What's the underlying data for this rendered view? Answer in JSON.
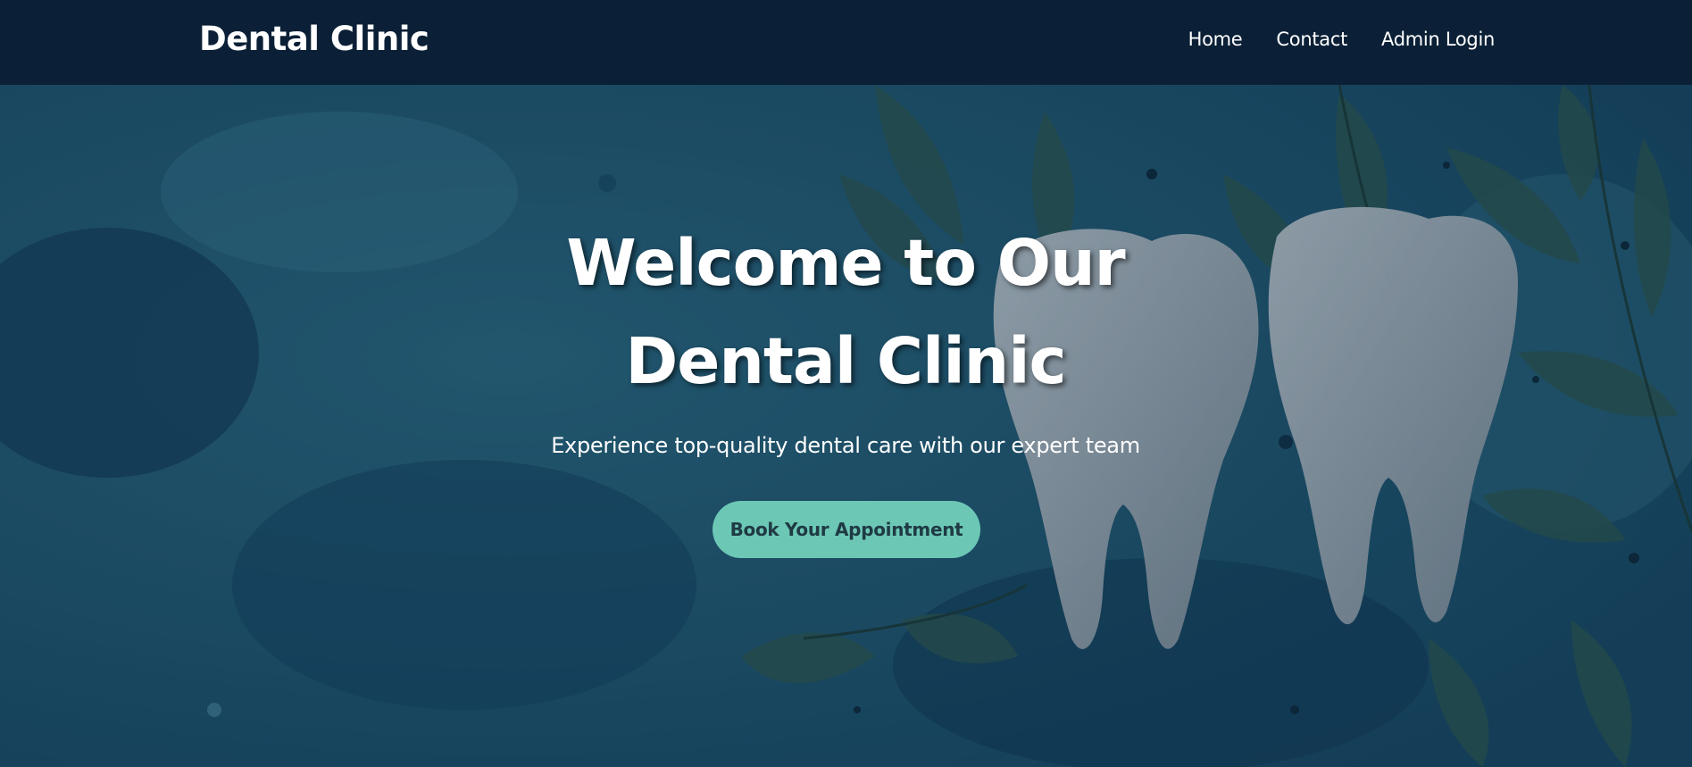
{
  "navbar": {
    "brand": "Dental Clinic",
    "links": [
      "Home",
      "Contact",
      "Admin Login"
    ]
  },
  "hero": {
    "title": "Welcome to Our Dental Clinic",
    "subtitle": "Experience top-quality dental care with our expert team",
    "cta_label": "Book Your Appointment",
    "image": "tooth-leaves-illustration"
  },
  "colors": {
    "navbar_bg": "#0b2036",
    "hero_bg": "#1f5a72",
    "cta_bg": "#6cc8b5",
    "cta_text": "#1f3a44",
    "text": "#ffffff"
  }
}
